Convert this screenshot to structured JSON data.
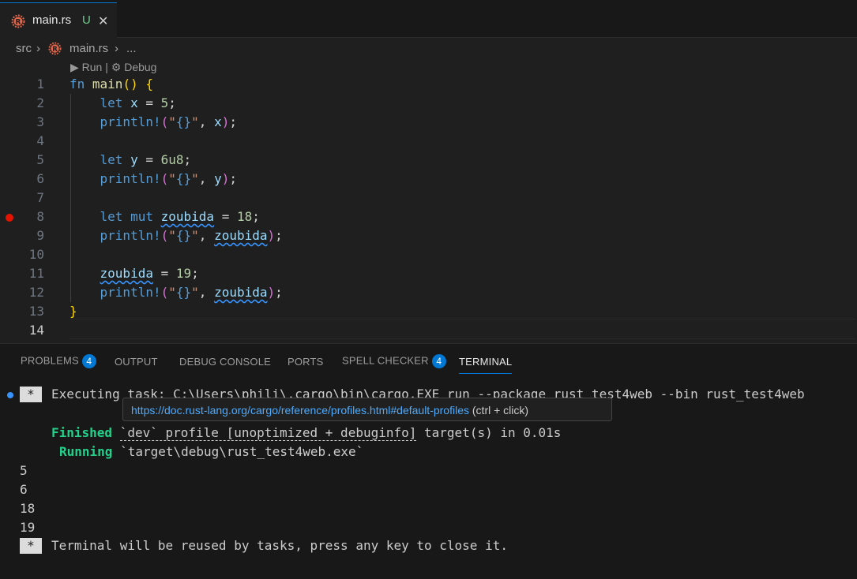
{
  "tab": {
    "file_name": "main.rs",
    "status": "U",
    "close_glyph": "✕",
    "icon": "rust-icon"
  },
  "breadcrumb": {
    "folder": "src",
    "sep1": "›",
    "file": "main.rs",
    "sep2": "›",
    "more": "..."
  },
  "codelens": {
    "run": "▶ Run",
    "sep": "|",
    "debug": "⚙ Debug"
  },
  "editor": {
    "line_numbers": [
      "1",
      "2",
      "3",
      "4",
      "5",
      "6",
      "7",
      "8",
      "9",
      "10",
      "11",
      "12",
      "13",
      "14"
    ],
    "active_line": "14",
    "breakpoint_line": "8"
  },
  "code": {
    "l1": {
      "kw": "fn",
      "name": "main",
      "paren": "()",
      "brace": "{"
    },
    "l2": {
      "kw": "let",
      "var": "x",
      "eq": "=",
      "val": "5",
      "semi": ";"
    },
    "l3": {
      "mac": "println!",
      "open": "(",
      "q1": "\"",
      "fmt": "{}",
      "q2": "\"",
      "comma": ",",
      "arg": "x",
      "close": ")",
      "semi": ";"
    },
    "l5": {
      "kw": "let",
      "var": "y",
      "eq": "=",
      "val": "6u8",
      "semi": ";"
    },
    "l6": {
      "mac": "println!",
      "open": "(",
      "q1": "\"",
      "fmt": "{}",
      "q2": "\"",
      "comma": ",",
      "arg": "y",
      "close": ")",
      "semi": ";"
    },
    "l8": {
      "kw": "let",
      "kw2": "mut",
      "var": "zoubida",
      "eq": "=",
      "val": "18",
      "semi": ";"
    },
    "l9": {
      "mac": "println!",
      "open": "(",
      "q1": "\"",
      "fmt": "{}",
      "q2": "\"",
      "comma": ",",
      "arg": "zoubida",
      "close": ")",
      "semi": ";"
    },
    "l11": {
      "var": "zoubida",
      "eq": "=",
      "val": "19",
      "semi": ";"
    },
    "l12": {
      "mac": "println!",
      "open": "(",
      "q1": "\"",
      "fmt": "{}",
      "q2": "\"",
      "comma": ",",
      "arg": "zoubida",
      "close": ")",
      "semi": ";"
    },
    "l13": {
      "brace": "}"
    }
  },
  "panel": {
    "tabs": [
      {
        "label": "PROBLEMS",
        "badge": "4"
      },
      {
        "label": "OUTPUT"
      },
      {
        "label": "DEBUG CONSOLE"
      },
      {
        "label": "PORTS"
      },
      {
        "label": "SPELL CHECKER",
        "badge": "4"
      },
      {
        "label": "TERMINAL"
      }
    ],
    "active_tab": "TERMINAL"
  },
  "terminal": {
    "star": "*",
    "exec_line": "Executing task: C:\\Users\\phili\\.cargo\\bin\\cargo.EXE run --package rust_test4web --bin rust_test4web",
    "finished_word": "Finished",
    "finished_profile": "`dev` profile [unoptimized + debuginfo]",
    "finished_rest": " target(s) in 0.01s",
    "running_word": "Running",
    "running_rest": " `target\\debug\\rust_test4web.exe`",
    "outputs": [
      "5",
      "6",
      "18",
      "19"
    ],
    "close_line": "Terminal will be reused by tasks, press any key to close it."
  },
  "hover": {
    "url": "https://doc.rust-lang.org/cargo/reference/profiles.html#default-profiles",
    "hint": "(ctrl + click)"
  },
  "colors": {
    "accent": "#0078d4",
    "breakpoint": "#e51400",
    "terminal_green": "#23d18b",
    "untracked": "#73c991"
  }
}
